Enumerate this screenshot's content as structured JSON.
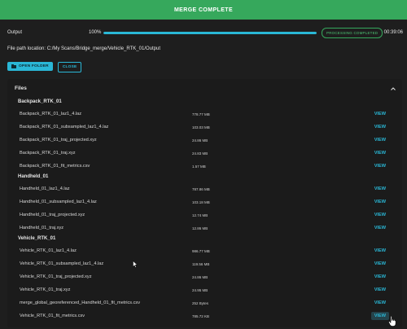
{
  "banner": {
    "title": "MERGE COMPLETE",
    "color": "#36a85c"
  },
  "output": {
    "label": "Output",
    "percent_text": "100%",
    "progress": 1.0,
    "status": "PROCESSING COMPLETED",
    "elapsed": "00:39:06"
  },
  "path": {
    "label": "File path location:",
    "value": "C:/My Scans/Bridge_merge/Vehicle_RTK_01/Output"
  },
  "buttons": {
    "open_folder": "OPEN FOLDER",
    "close": "CLOSE"
  },
  "files": {
    "header": "Files",
    "view_label": "VIEW",
    "groups": [
      {
        "name": "Backpack_RTK_01",
        "items": [
          {
            "name": "Backpack_RTK_01_laz1_4.laz",
            "size": "778.77 MB"
          },
          {
            "name": "Backpack_RTK_01_subsampled_laz1_4.laz",
            "size": "103.03 MB"
          },
          {
            "name": "Backpack_RTK_01_traj_projected.xyz",
            "size": "24.86 MB"
          },
          {
            "name": "Backpack_RTK_01_traj.xyz",
            "size": "24.83 MB"
          },
          {
            "name": "Backpack_RTK_01_fit_metrics.csv",
            "size": "1.57 MB"
          }
        ]
      },
      {
        "name": "Handheld_01",
        "items": [
          {
            "name": "Handheld_01_laz1_4.laz",
            "size": "787.86 MB"
          },
          {
            "name": "Handheld_01_subsampled_laz1_4.laz",
            "size": "103.18 MB"
          },
          {
            "name": "Handheld_01_traj_projected.xyz",
            "size": "12.74 MB"
          },
          {
            "name": "Handheld_01_traj.xyz",
            "size": "12.86 MB"
          }
        ]
      },
      {
        "name": "Vehicle_RTK_01",
        "items": [
          {
            "name": "Vehicle_RTK_01_laz1_4.laz",
            "size": "986.77 MB"
          },
          {
            "name": "Vehicle_RTK_01_subsampled_laz1_4.laz",
            "size": "119.56 MB"
          },
          {
            "name": "Vehicle_RTK_01_traj_projected.xyz",
            "size": "24.86 MB"
          },
          {
            "name": "Vehicle_RTK_01_traj.xyz",
            "size": "24.95 MB"
          },
          {
            "name": "merge_global_georeferenced_Handheld_01_fit_metrics.csv",
            "size": "252 Bytes"
          },
          {
            "name": "Vehicle_RTK_01_fit_metrics.csv",
            "size": "785.72 KB"
          }
        ]
      }
    ]
  }
}
